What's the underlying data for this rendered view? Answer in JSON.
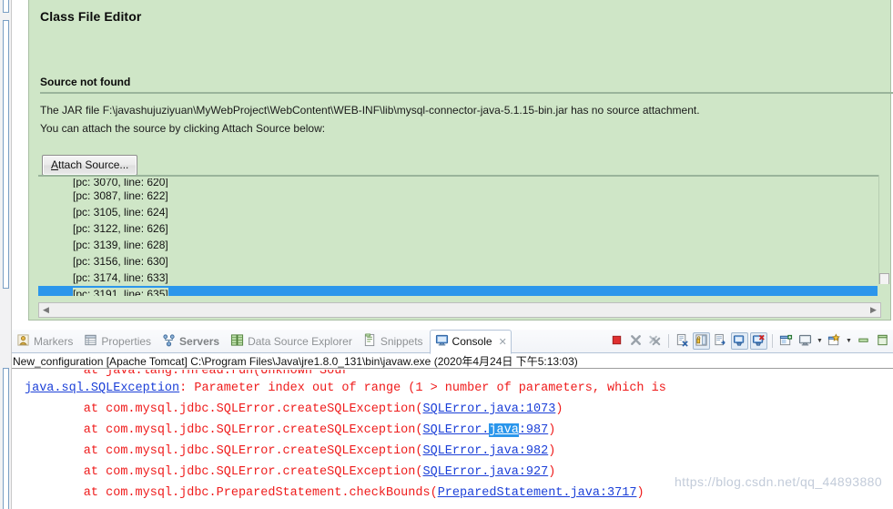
{
  "editor": {
    "title": "Class File Editor",
    "source_not_found_heading": "Source not found",
    "message_line_1": "The JAR file F:\\javashujuziyuan\\MyWebProject\\WebContent\\WEB-INF\\lib\\mysql-connector-java-5.1.15-bin.jar has no source attachment.",
    "message_line_2": "You can attach the source by clicking Attach Source below:",
    "attach_source_button": "Attach Source...",
    "attach_source_mnemonic": "A",
    "attach_source_rest": "ttach Source...",
    "bytecode_lines": [
      "[pc: 3070, line: 620]",
      "[pc: 3087, line: 622]",
      "[pc: 3105, line: 624]",
      "[pc: 3122, line: 626]",
      "[pc: 3139, line: 628]",
      "[pc: 3156, line: 630]",
      "[pc: 3174, line: 633]",
      "[pc: 3191, line: 635]"
    ],
    "selected_bytecode_index": 7
  },
  "console_view": {
    "tabs": [
      {
        "label": "Markers",
        "icon": "markers-icon",
        "active": false,
        "bold": false
      },
      {
        "label": "Properties",
        "icon": "properties-icon",
        "active": false,
        "bold": false
      },
      {
        "label": "Servers",
        "icon": "servers-icon",
        "active": false,
        "bold": true
      },
      {
        "label": "Data Source Explorer",
        "icon": "data-source-explorer-icon",
        "active": false,
        "bold": false
      },
      {
        "label": "Snippets",
        "icon": "snippets-icon",
        "active": false,
        "bold": false
      },
      {
        "label": "Console",
        "icon": "console-icon",
        "active": true,
        "bold": false
      }
    ],
    "close_glyph": "✕",
    "toolbar": [
      {
        "name": "terminate-button",
        "icon": "stop-square-icon",
        "pressed": false
      },
      {
        "name": "remove-launch-button",
        "icon": "remove-x-icon",
        "pressed": false
      },
      {
        "name": "remove-all-terminated-button",
        "icon": "remove-all-xx-icon",
        "pressed": false
      },
      {
        "name": "separator-1",
        "icon": "separator",
        "pressed": false
      },
      {
        "name": "clear-console-button",
        "icon": "clear-console-icon",
        "pressed": false
      },
      {
        "name": "scroll-lock-button",
        "icon": "scroll-lock-icon",
        "pressed": true
      },
      {
        "name": "word-wrap-button",
        "icon": "word-wrap-icon",
        "pressed": false
      },
      {
        "name": "show-console-on-output-button",
        "icon": "show-console-stdout-icon",
        "pressed": true
      },
      {
        "name": "show-console-on-error-button",
        "icon": "show-console-stderr-icon",
        "pressed": true
      },
      {
        "name": "separator-2",
        "icon": "separator",
        "pressed": false
      },
      {
        "name": "pin-console-button",
        "icon": "pin-console-icon",
        "pressed": false
      },
      {
        "name": "display-selected-console-button",
        "icon": "display-console-icon",
        "pressed": false
      },
      {
        "name": "display-selected-console-dropdown",
        "icon": "chevron-down-icon",
        "pressed": false
      },
      {
        "name": "open-console-button",
        "icon": "open-console-icon",
        "pressed": false
      },
      {
        "name": "open-console-dropdown",
        "icon": "chevron-down-icon",
        "pressed": false
      },
      {
        "name": "minimize-view-button",
        "icon": "minimize-icon",
        "pressed": false
      },
      {
        "name": "maximize-view-button",
        "icon": "maximize-icon",
        "pressed": false
      }
    ],
    "process_label": "New_configuration [Apache Tomcat] C:\\Program Files\\Java\\jre1.8.0_131\\bin\\javaw.exe (2020年4月24日 下午5:13:03)",
    "output": {
      "partial_top_line": "        at java.lang.Thread.run(Unknown Sour",
      "lines": [
        {
          "segments": [
            {
              "text": "java.sql.SQLException",
              "style": "link"
            },
            {
              "text": ": Parameter index out of range (1 > number of parameters, which is ",
              "style": "error"
            }
          ]
        },
        {
          "segments": [
            {
              "text": "        at com.mysql.jdbc.SQLError.createSQLException(",
              "style": "error"
            },
            {
              "text": "SQLError.java:1073",
              "style": "link"
            },
            {
              "text": ")",
              "style": "error"
            }
          ]
        },
        {
          "segments": [
            {
              "text": "        at com.mysql.jdbc.SQLError.createSQLException(",
              "style": "error"
            },
            {
              "text": "SQLError.",
              "style": "link"
            },
            {
              "text": "java",
              "style": "link-selected"
            },
            {
              "text": ":987",
              "style": "link"
            },
            {
              "text": ")",
              "style": "error"
            }
          ]
        },
        {
          "segments": [
            {
              "text": "        at com.mysql.jdbc.SQLError.createSQLException(",
              "style": "error"
            },
            {
              "text": "SQLError.java:982",
              "style": "link"
            },
            {
              "text": ")",
              "style": "error"
            }
          ]
        },
        {
          "segments": [
            {
              "text": "        at com.mysql.jdbc.SQLError.createSQLException(",
              "style": "error"
            },
            {
              "text": "SQLError.java:927",
              "style": "link"
            },
            {
              "text": ")",
              "style": "error"
            }
          ]
        },
        {
          "segments": [
            {
              "text": "        at com.mysql.jdbc.PreparedStatement.checkBounds(",
              "style": "error"
            },
            {
              "text": "PreparedStatement.java:3717",
              "style": "link"
            },
            {
              "text": ")",
              "style": "error"
            }
          ]
        }
      ]
    }
  },
  "watermark": "https://blog.csdn.net/qq_44893880",
  "colors": {
    "editor_background": "#cfe6c7",
    "selection_blue": "#2b96eb",
    "error_red": "#ef1b1b",
    "link_blue": "#1c40d8"
  }
}
